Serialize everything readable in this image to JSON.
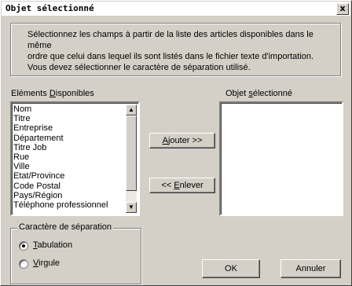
{
  "window": {
    "title": "Objet sélectionné",
    "close_label": "x"
  },
  "instructions": {
    "line1": "Sélectionnez les champs à partir de la liste des articles disponibles dans le même",
    "line2": "ordre que celui dans lequel ils sont listés dans le fichier texte d'importation.",
    "line3": "Vous devez sélectionner le caractère de séparation utilisé."
  },
  "available": {
    "label_before": "Eléments ",
    "label_mnemonic": "D",
    "label_after": "isponibles",
    "items": [
      "Nom",
      "Titre",
      "Entreprise",
      "Département",
      "Titre Job",
      "Rue",
      "Ville",
      "Etat/Province",
      "Code Postal",
      "Pays/Région",
      "Téléphone professionnel"
    ]
  },
  "selected": {
    "label_before": "Objet ",
    "label_mnemonic": "s",
    "label_after": "électionné",
    "items": []
  },
  "buttons": {
    "add_mnemonic": "A",
    "add_rest": "jouter >>",
    "remove_prefix": "<< ",
    "remove_mnemonic": "E",
    "remove_rest": "nlever",
    "ok": "OK",
    "cancel": "Annuler"
  },
  "separator": {
    "legend": "Caractère de séparation",
    "tab_mnemonic": "T",
    "tab_rest": "abulation",
    "comma_mnemonic": "V",
    "comma_rest": "irgule",
    "selected": "tabulation"
  },
  "icons": {
    "scroll_up": "up-arrow-icon",
    "scroll_down": "down-arrow-icon"
  }
}
